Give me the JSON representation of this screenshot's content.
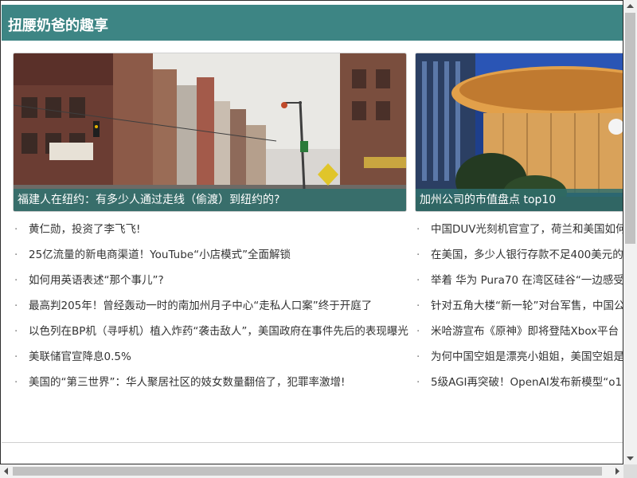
{
  "header": {
    "title": "扭腰奶爸的趣享"
  },
  "cards": [
    {
      "caption": "福建人在纽约：有多少人通过走线（偷渡）到纽约的?"
    },
    {
      "caption": "加州公司的市值盘点 top10"
    }
  ],
  "list_left": [
    "黄仁勋，投资了李飞飞!",
    "25亿流量的新电商渠道！YouTube“小店模式”全面解锁",
    "如何用英语表述“那个事儿”?",
    "最高判205年！曾经轰动一时的南加州月子中心“走私人口案”终于开庭了",
    "以色列在BP机（寻呼机）植入炸药“袭击敌人”，美国政府在事件先后的表现曝光",
    "美联储官宣降息0.5%",
    "美国的“第三世界”：华人聚居社区的妓女数量翻倍了，犯罪率激增!"
  ],
  "list_right": [
    "中国DUV光刻机官宣了，荷兰和美国如何",
    "在美国，多少人银行存款不足400美元的",
    "举着 华为 Pura70 在湾区硅谷“一边感受",
    "针对五角大楼“新一轮”对台军售，中国公",
    "米哈游宣布《原神》即将登陆Xbox平台",
    "为何中国空姐是漂亮小姐姐，美国空姐是",
    "5级AGI再突破！OpenAI发布新模型“o1"
  ],
  "bullet": "·",
  "colors": {
    "header_bg": "#3d8584",
    "caption_bg": "#2f6e6c"
  },
  "icons": {
    "scroll_up": "arrow-up-icon",
    "scroll_down": "arrow-down-icon",
    "scroll_left": "arrow-left-icon",
    "scroll_right": "arrow-right-icon"
  }
}
